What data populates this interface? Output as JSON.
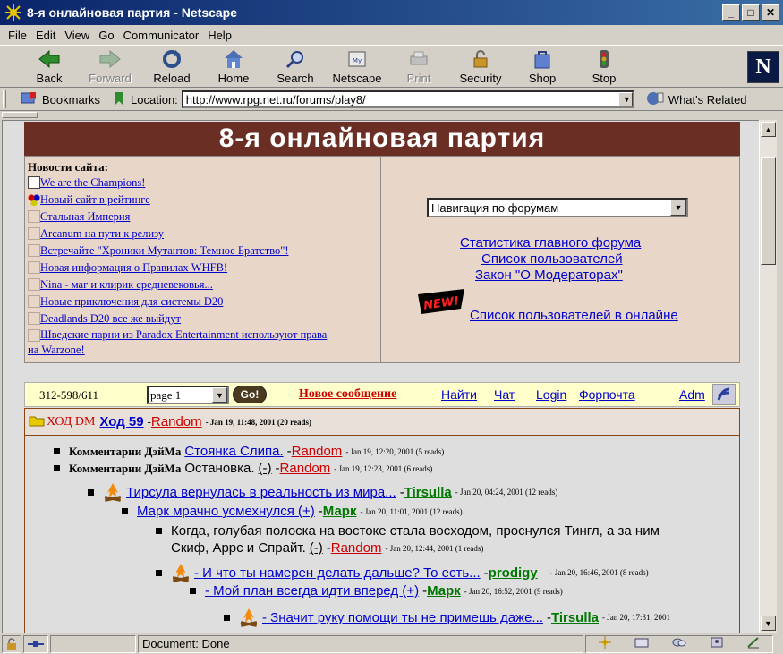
{
  "window": {
    "title": "8-я онлайновая партия - Netscape"
  },
  "menu": [
    "File",
    "Edit",
    "View",
    "Go",
    "Communicator",
    "Help"
  ],
  "toolbar": [
    {
      "label": "Back",
      "icon": "back-icon"
    },
    {
      "label": "Forward",
      "icon": "forward-icon",
      "disabled": true
    },
    {
      "label": "Reload",
      "icon": "reload-icon"
    },
    {
      "label": "Home",
      "icon": "home-icon"
    },
    {
      "label": "Search",
      "icon": "search-icon"
    },
    {
      "label": "Netscape",
      "icon": "netscape-icon"
    },
    {
      "label": "Print",
      "icon": "print-icon",
      "disabled": true
    },
    {
      "label": "Security",
      "icon": "lock-icon"
    },
    {
      "label": "Shop",
      "icon": "shop-icon"
    },
    {
      "label": "Stop",
      "icon": "stop-icon"
    }
  ],
  "logo_letter": "N",
  "location": {
    "bookmarks_label": "Bookmarks",
    "location_label": "Location:",
    "url": "http://www.rpg.net.ru/forums/play8/",
    "related_label": "What's Related"
  },
  "page": {
    "banner_title": "8-я онлайновая партия",
    "news_header": "Новости сайта:",
    "news": [
      "We are the Champions!",
      "Новый сайт в рейтинге",
      "Стальная Империя",
      "Arcanum на пути к релизу",
      "Встречайте \"Хроники Мутантов: Темное Братство\"!",
      "Новая информация о Правилах WHFB!",
      "Nina - маг и клирик средневековья...",
      "Новые приключения для системы D20",
      "Deadlands D20 все же выйдут",
      "Шведские парни из Paradox Entertainment используют права",
      "на Warzone!"
    ],
    "forum_select": "Навигация по форумам",
    "links": {
      "stats": "Статистика главного форума",
      "users": "Список пользователей",
      "law": "Закон \"О Модераторах\"",
      "online": "Список пользователей в онлайне"
    },
    "new_badge": "NEW!",
    "forumbar": {
      "count": "312-598/611",
      "page_select": "page 1",
      "go": "Go!",
      "new_post": "Новое сообщение",
      "find": "Найти",
      "chat": "Чат",
      "login": "Login",
      "forpochta": "Форпочта",
      "adm": "Adm"
    },
    "thread_header": {
      "prefix": "ХОД DM",
      "title": "Ход 59",
      "author": "Random",
      "meta": "- Jan 19, 11:48, 2001 (20 reads)"
    },
    "posts": [
      {
        "label": "Комментарии ДэйМа",
        "title": "Стоянка Слипа.",
        "author": "Random",
        "meta": "- Jan 19, 12:20, 2001 (5 reads)"
      },
      {
        "label": "Комментарии ДэйМа",
        "title": "Остановка.",
        "extra": "(-)",
        "author": "Random",
        "meta": "- Jan 19, 12:23, 2001 (6 reads)"
      },
      {
        "title": "Тирсула вернулась в реальность из мира...",
        "author": "Tirsulla",
        "meta": "- Jan 20, 04:24, 2001 (12 reads)"
      },
      {
        "title": "Марк мрачно усмехнулся (+)",
        "author": "Марк",
        "meta": "- Jan 20, 11:01, 2001 (12 reads)"
      },
      {
        "line1": "Когда, голубая полоска на востоке стала восходом, проснулся Тингл, а за ним",
        "line2": "Скиф, Аррс и Спрайт.",
        "extra": "(-)",
        "author": "Random",
        "meta": "- Jan 20, 12:44, 2001 (1 reads)"
      },
      {
        "title": "- И что ты намерен делать дальше? То есть...",
        "author": "prodigy",
        "meta": "- Jan 20, 16:46, 2001 (8 reads)"
      },
      {
        "title": "- Мой план всегда идти вперед (+)",
        "author": "Марк",
        "meta": "- Jan 20, 16:52, 2001 (9 reads)"
      },
      {
        "title": "- Значит руку помощи ты не примешь даже...",
        "author": "Tirsulla",
        "meta": "- Jan 20, 17:31, 2001"
      }
    ]
  },
  "status": {
    "text": "Document: Done"
  }
}
